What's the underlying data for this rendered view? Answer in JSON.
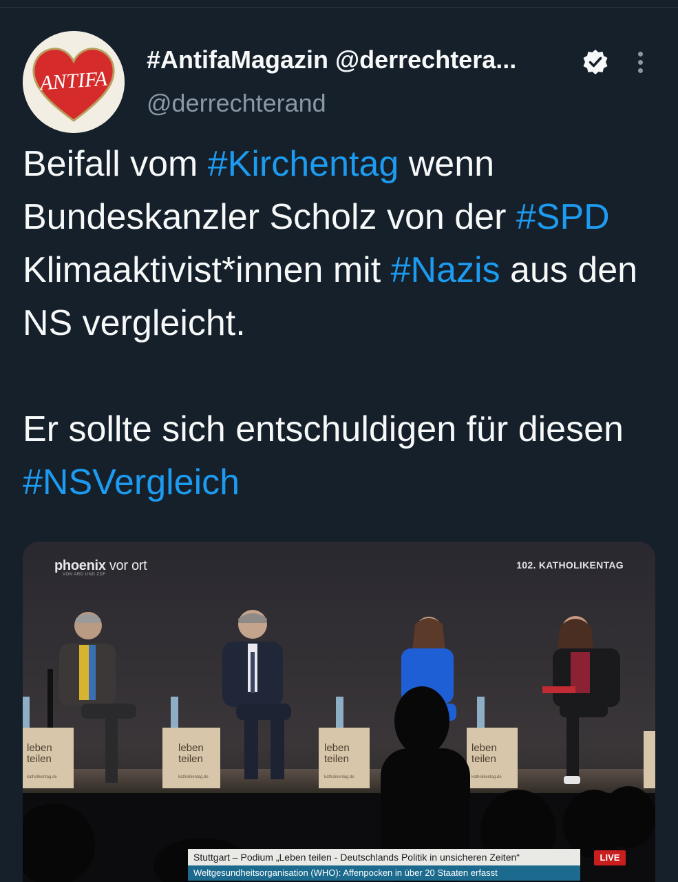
{
  "author": {
    "display_name": "#AntifaMagazin @derrechtera...",
    "handle": "@derrechterand",
    "avatar_text": "ANTIFA"
  },
  "tweet": {
    "p1_t1": "Beifall vom ",
    "p1_h1": "#Kirchentag",
    "p1_t2": " wenn Bundeskanzler Scholz von der ",
    "p1_h2": "#SPD",
    "p1_t3": " Klimaaktivist*innen mit ",
    "p1_h3": "#Nazis",
    "p1_t4": " aus den NS vergleicht.",
    "p2_t1": "Er sollte sich entschuldigen für diesen  ",
    "p2_h1": "#NSVergleich"
  },
  "media": {
    "brand_main": "phoenix",
    "brand_light": " vor ort",
    "brand_sub": "VON ARD UND ZDF",
    "event": "102. KATHOLIKENTAG",
    "box_line1": "leben",
    "box_line2": "teilen",
    "box_url": "katholikentag.de",
    "lower_third_title": "Stuttgart – Podium „Leben teilen - Deutschlands Politik in unsicheren Zeiten“",
    "lower_third_ticker": "Weltgesundheitsorganisation (WHO): Affenpocken in über 20 Staaten erfasst",
    "live_label": "LIVE"
  },
  "colors": {
    "background": "#15202b",
    "hashtag": "#1d9bf0",
    "secondary_text": "#8b98a5"
  }
}
